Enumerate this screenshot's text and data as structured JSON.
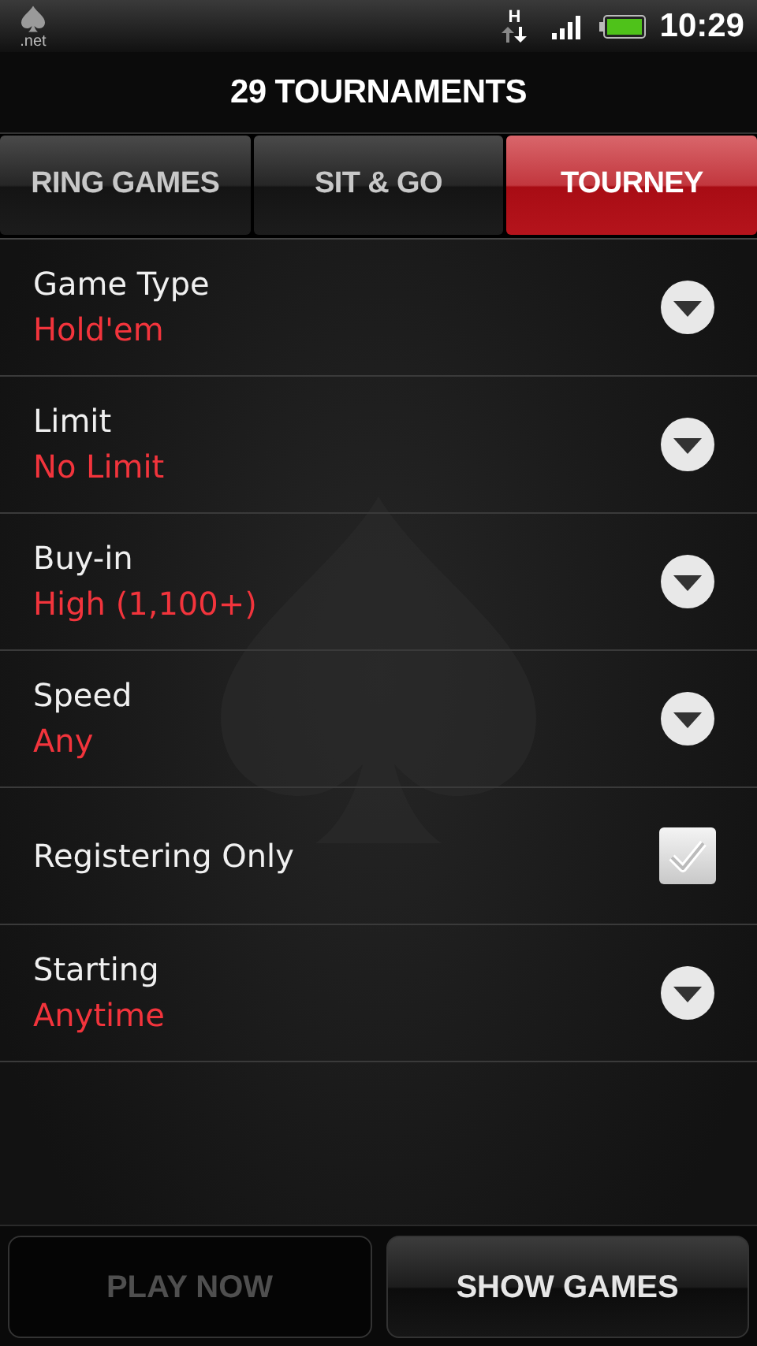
{
  "status_bar": {
    "logo_text": ".net",
    "network": "H",
    "time": "10:29"
  },
  "title": "29 TOURNAMENTS",
  "tabs": [
    {
      "label": "RING GAMES",
      "selected": false
    },
    {
      "label": "SIT & GO",
      "selected": false
    },
    {
      "label": "TOURNEY",
      "selected": true
    }
  ],
  "filters": [
    {
      "kind": "dropdown",
      "label": "Game Type",
      "value": "Hold'em"
    },
    {
      "kind": "dropdown",
      "label": "Limit",
      "value": "No Limit"
    },
    {
      "kind": "dropdown",
      "label": "Buy-in",
      "value": "High (1,100+)"
    },
    {
      "kind": "dropdown",
      "label": "Speed",
      "value": "Any"
    },
    {
      "kind": "checkbox",
      "label": "Registering Only",
      "checked": true
    },
    {
      "kind": "dropdown",
      "label": "Starting",
      "value": "Anytime"
    }
  ],
  "buttons": [
    {
      "label": "PLAY NOW",
      "disabled": true
    },
    {
      "label": "SHOW GAMES",
      "disabled": false
    }
  ]
}
